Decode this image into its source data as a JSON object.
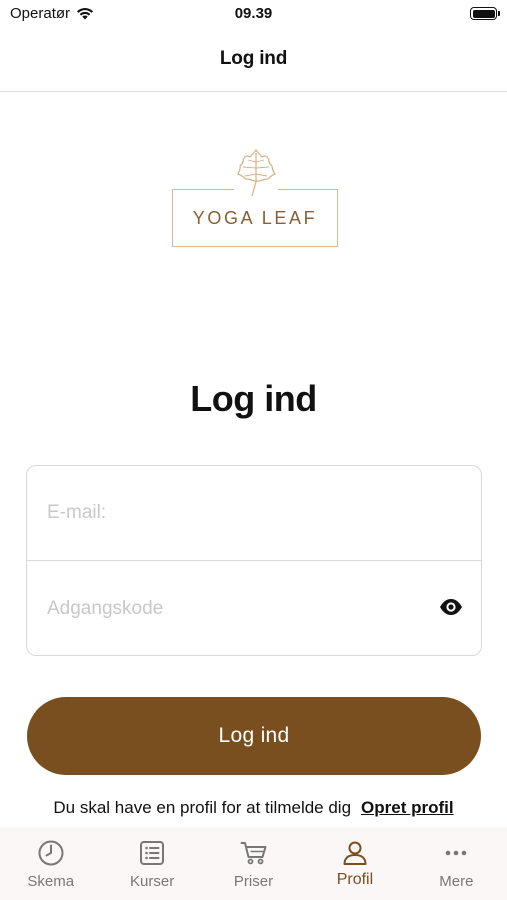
{
  "status_bar": {
    "carrier": "Operatør",
    "time": "09.39"
  },
  "nav": {
    "title": "Log ind"
  },
  "logo": {
    "text": "YOGA LEAF",
    "color": "#8a5f31"
  },
  "heading": "Log ind",
  "form": {
    "email_placeholder": "E-mail:",
    "email_value": "",
    "password_placeholder": "Adgangskode",
    "password_value": "",
    "password_toggle_icon": "eye-icon"
  },
  "login_button": {
    "label": "Log ind",
    "color": "#7a4f20"
  },
  "signup": {
    "text": "Du skal have en profil for at tilmelde dig",
    "link_label": "Opret profil"
  },
  "tabbar": {
    "active_color": "#7a4f20",
    "items": [
      {
        "label": "Skema",
        "icon": "clock-icon",
        "active": false
      },
      {
        "label": "Kurser",
        "icon": "list-icon",
        "active": false
      },
      {
        "label": "Priser",
        "icon": "cart-icon",
        "active": false
      },
      {
        "label": "Profil",
        "icon": "person-icon",
        "active": true
      },
      {
        "label": "Mere",
        "icon": "more-icon",
        "active": false
      }
    ]
  }
}
